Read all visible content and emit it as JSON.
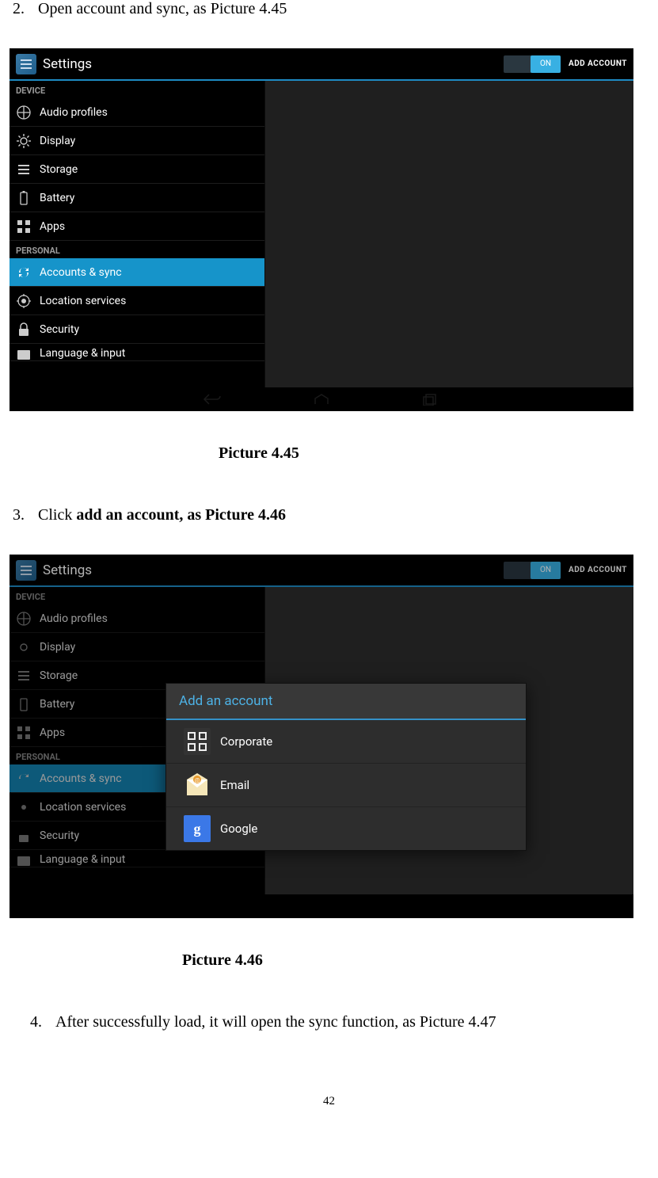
{
  "steps": {
    "s2": {
      "num": "2.",
      "text": "Open account and sync, as Picture 4.45"
    },
    "s3": {
      "num": "3.",
      "pre": "Click ",
      "bold": "add an account, as Picture 4.46"
    },
    "s4": {
      "num": "4.",
      "text": "After successfully load, it will open the sync function, as Picture 4.47"
    }
  },
  "captions": {
    "c1": "Picture 4.45",
    "c2": "Picture 4.46"
  },
  "page_number": "42",
  "screenshot": {
    "header_title": "Settings",
    "toggle_label": "ON",
    "add_account": "ADD ACCOUNT",
    "sections": {
      "device": "DEVICE",
      "personal": "PERSONAL"
    },
    "items": {
      "audio": "Audio profiles",
      "display": "Display",
      "storage": "Storage",
      "battery": "Battery",
      "apps": "Apps",
      "accounts": "Accounts & sync",
      "location": "Location services",
      "security": "Security",
      "lang": "Language & input"
    }
  },
  "dialog": {
    "title": "Add an account",
    "items": {
      "corporate": "Corporate",
      "email": "Email",
      "google": "Google"
    }
  }
}
